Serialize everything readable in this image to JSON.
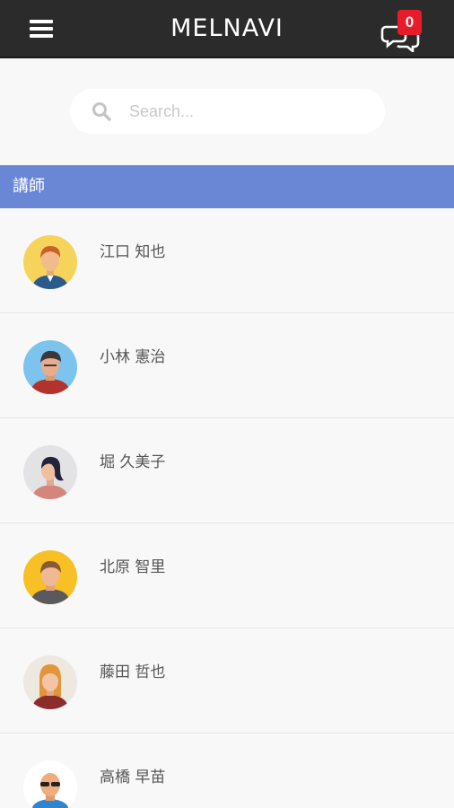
{
  "header": {
    "title": "MELNAVI",
    "chat_badge": "0"
  },
  "search": {
    "placeholder": "Search..."
  },
  "section": {
    "title": "講師"
  },
  "teachers": [
    {
      "name": "江口 知也",
      "avatar": "man-orange-hair-blue-jacket"
    },
    {
      "name": "小林 憲治",
      "avatar": "man-dark-hair-red-shirt"
    },
    {
      "name": "堀 久美子",
      "avatar": "woman-dark-bun-pink-top"
    },
    {
      "name": "北原 智里",
      "avatar": "man-brown-hair-gray-hoodie"
    },
    {
      "name": "藤田 哲也",
      "avatar": "woman-blonde-hair-red-top"
    },
    {
      "name": "高橋 早苗",
      "avatar": "man-bald-sunglasses-blue-shirt"
    }
  ],
  "colors": {
    "topbar": "#2b2b2b",
    "accent": "#6a87d5",
    "badge": "#e81b2a"
  }
}
